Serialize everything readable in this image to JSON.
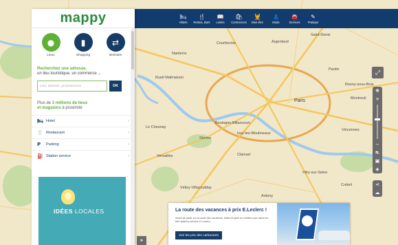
{
  "brand": {
    "logo_text": "mappy"
  },
  "topnav": {
    "items": [
      {
        "icon": "bed-icon",
        "glyph": "🛏",
        "label": "Hôtels"
      },
      {
        "icon": "fork-knife-icon",
        "glyph": "🍴",
        "label": "Restos, Bars"
      },
      {
        "icon": "book-icon",
        "glyph": "📖",
        "label": "Loisirs"
      },
      {
        "icon": "shop-icon",
        "glyph": "🛍",
        "label": "Commerces"
      },
      {
        "icon": "wellness-icon",
        "glyph": "💆",
        "label": "Bien-être"
      },
      {
        "icon": "dress-icon",
        "glyph": "👗",
        "label": "Mode"
      },
      {
        "icon": "car-icon",
        "glyph": "🚘",
        "label": "Services"
      },
      {
        "icon": "pen-icon",
        "glyph": "✎",
        "label": "Pratique"
      }
    ]
  },
  "panel": {
    "modes": [
      {
        "icon": "location-pin-icon",
        "glyph": "●",
        "label": "Lieux",
        "color": "#5fb135"
      },
      {
        "icon": "shopping-bag-icon",
        "glyph": "▮",
        "label": "Shopping",
        "color": "#163c66"
      },
      {
        "icon": "signpost-icon",
        "glyph": "⇄",
        "label": "Itinéraire",
        "color": "#163c66"
      }
    ],
    "hint_strong": "Recherchez une adresse,",
    "hint_rest": "un lieu touristique, un commerce ...",
    "search": {
      "placeholder": "Lieu, adresse, professionnel",
      "value": "",
      "ok_label": "OK"
    },
    "stats_prefix": "Plus de ",
    "stats_strong": "3 millions de lieux",
    "stats_line2_strong": "et magasins",
    "stats_line2_rest": " à proximité",
    "categories": [
      {
        "icon": "bed-icon",
        "glyph": "🛏",
        "label": "Hotel"
      },
      {
        "icon": "fork-knife-icon",
        "glyph": "🍴",
        "label": "Restaurant"
      },
      {
        "icon": "parking-icon",
        "glyph": "P",
        "label": "Parking"
      },
      {
        "icon": "fuel-icon",
        "glyph": "⛽",
        "label": "Station service"
      }
    ],
    "ad": {
      "text_strong": "IDÉES",
      "text_rest": " LOCALES"
    }
  },
  "map_labels": {
    "paris": "Paris",
    "boulogne": "Boulogne-Billancourt",
    "montreuil": "Montreuil",
    "nanterre": "Nanterre",
    "courbevoie": "Courbevoie",
    "saint_denis": "Saint-Denis",
    "versailles": "Versailles",
    "vincennes": "Vincennes",
    "issy": "Issy-les-Moulineaux",
    "le_chesnay": "Le Chesnay",
    "clamart": "Clamart",
    "vitry": "Vitry-sur-Seine",
    "sevres": "Sèvres",
    "rueil": "Rueil-Malmaison",
    "argenteuil": "Argenteuil",
    "pantin": "Pantin",
    "creteil": "Créteil",
    "velizy": "Vélizy-Villacoublay",
    "antony": "Antony",
    "rosny": "Rosny-sous-Bois"
  },
  "promo": {
    "title": "La route des vacances à prix E.Leclerc !",
    "body": "Avant de partir sur la route des vacances, faites le plein au meilleur prix dans les 600 stations-service E.Leclerc.",
    "button": "Voir les prix des carburants"
  },
  "colors": {
    "brand_green": "#5fb135",
    "brand_navy": "#163c66",
    "topbar": "#123b6e"
  }
}
